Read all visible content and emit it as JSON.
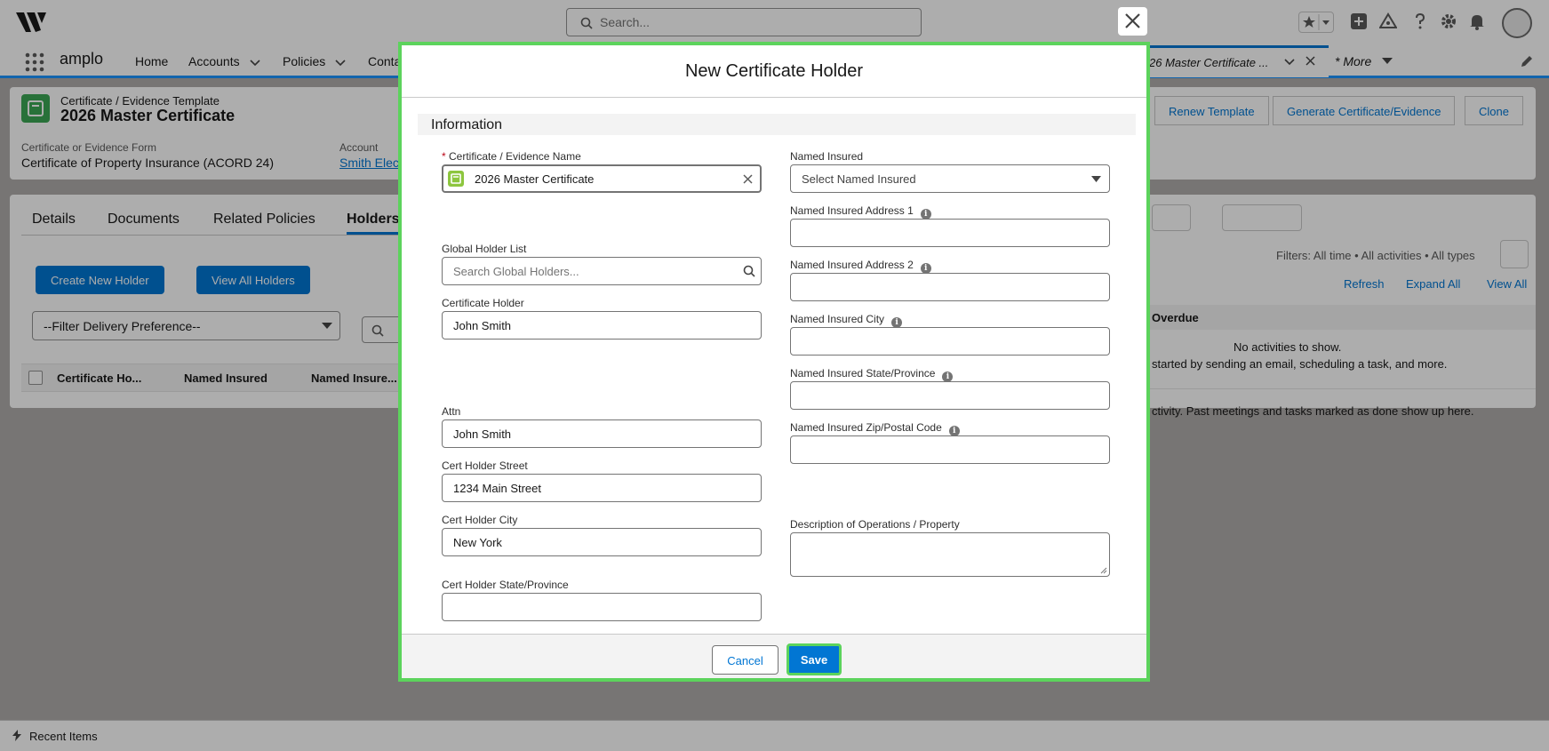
{
  "global_header": {
    "search_placeholder": "Search..."
  },
  "nav": {
    "app_name": "amplo",
    "items": [
      "Home",
      "Accounts",
      "Policies",
      "Conta"
    ],
    "open_tab": "26 Master Certificate ...",
    "more": "* More"
  },
  "record": {
    "type": "Certificate / Evidence Template",
    "title": "2026 Master Certificate",
    "buttons": [
      "Renew Template",
      "Generate Certificate/Evidence",
      "Clone"
    ],
    "field1_label": "Certificate or Evidence Form",
    "field1_value": "Certificate of Property Insurance (ACORD 24)",
    "field2_label": "Account",
    "field2_value": "Smith Elec"
  },
  "related": {
    "tabs": [
      "Details",
      "Documents",
      "Related Policies",
      "Holders"
    ],
    "create_button": "Create New Holder",
    "view_all_button": "View All Holders",
    "filter_value": "--Filter Delivery Preference--",
    "columns": [
      "Certificate Ho...",
      "Named Insured",
      "Named Insure..."
    ]
  },
  "activity": {
    "filters": "Filters: All time • All activities • All types",
    "refresh": "Refresh",
    "expand_all": "Expand All",
    "view_all": "View All",
    "overdue": "Overdue",
    "empty_title": "No activities to show.",
    "empty_sub": "started by sending an email, scheduling a task, and more.",
    "past": "ctivity. Past meetings and tasks marked as done show up here."
  },
  "footer": {
    "recent_items": "Recent Items"
  },
  "modal": {
    "title": "New Certificate Holder",
    "section": "Information",
    "cert_name_label": "Certificate / Evidence Name",
    "cert_name_value": "2026 Master Certificate",
    "global_holder_label": "Global Holder List",
    "global_holder_placeholder": "Search Global Holders...",
    "cert_holder_label": "Certificate Holder",
    "cert_holder_value": "John Smith",
    "attn_label": "Attn",
    "attn_value": "John Smith",
    "street_label": "Cert Holder Street",
    "street_value": "1234 Main Street",
    "city_label": "Cert Holder City",
    "city_value": "New York",
    "state_label": "Cert Holder State/Province",
    "state_value": "",
    "named_insured_label": "Named Insured",
    "named_insured_placeholder": "Select Named Insured",
    "ni_addr1_label": "Named Insured Address 1",
    "ni_addr2_label": "Named Insured Address 2",
    "ni_city_label": "Named Insured City",
    "ni_state_label": "Named Insured State/Province",
    "ni_zip_label": "Named Insured Zip/Postal Code",
    "desc_label": "Description of Operations / Property",
    "cancel": "Cancel",
    "save": "Save"
  },
  "colors": {
    "brand": "#0176d3",
    "highlight": "#5cd35c",
    "record_icon": "#3ba755"
  }
}
